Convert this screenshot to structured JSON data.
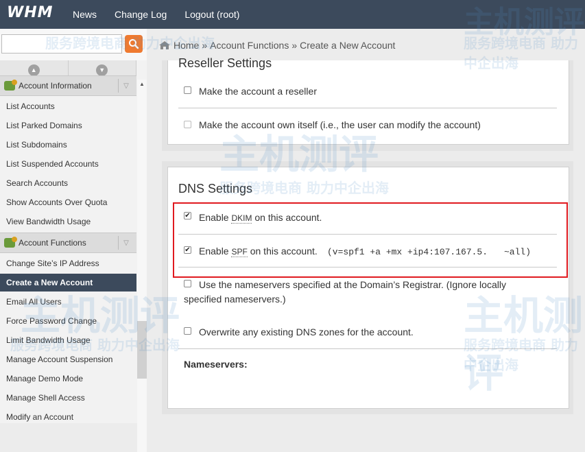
{
  "app": {
    "logo": "WHM"
  },
  "topnav": [
    "News",
    "Change Log",
    "Logout (root)"
  ],
  "search": {
    "placeholder": ""
  },
  "sidebar": {
    "group1": "Account Information",
    "group1_items": [
      "List Accounts",
      "List Parked Domains",
      "List Subdomains",
      "List Suspended Accounts",
      "Search Accounts",
      "Show Accounts Over Quota",
      "View Bandwidth Usage"
    ],
    "group2": "Account Functions",
    "group2_items": [
      "Change Site’s IP Address",
      "Create a New Account",
      "Email All Users",
      "Force Password Change",
      "Limit Bandwidth Usage",
      "Manage Account Suspension",
      "Manage Demo Mode",
      "Manage Shell Access",
      "Modify an Account"
    ],
    "active_item": "Create a New Account"
  },
  "breadcrumb": {
    "home": "Home",
    "sep": "»",
    "level1": "Account Functions",
    "level2": "Create a New Account"
  },
  "reseller": {
    "title": "Reseller Settings",
    "opt1": "Make the account a reseller",
    "opt2": "Make the account own itself (i.e., the user can modify the account)"
  },
  "dns": {
    "title": "DNS Settings",
    "dkim_pre": "Enable ",
    "dkim_abbr": "DKIM",
    "dkim_post": " on this account.",
    "spf_pre": "Enable ",
    "spf_abbr": "SPF",
    "spf_post": " on this account.",
    "spf_record_a": "(v=spf1 +a +mx +ip4:107.167.5.",
    "spf_record_b": "~all)",
    "ns_opt_line1": "Use the nameservers specified at the Domain’s Registrar. (Ignore locally",
    "ns_opt_line2": "specified nameservers.)",
    "overwrite": "Overwrite any existing DNS zones for the account.",
    "nameservers_label": "Nameservers:"
  },
  "checkbox_states": {
    "reseller": false,
    "own_itself": false,
    "dkim": true,
    "spf": true,
    "use_registrar_ns": false,
    "overwrite": false
  },
  "watermark": {
    "brand": "主机测评",
    "tagline": "服务跨境电商 助力中企出海"
  },
  "colors": {
    "topbar": "#3c4a5c",
    "search_button": "#ef7a30",
    "highlight_box": "#e0191f"
  }
}
